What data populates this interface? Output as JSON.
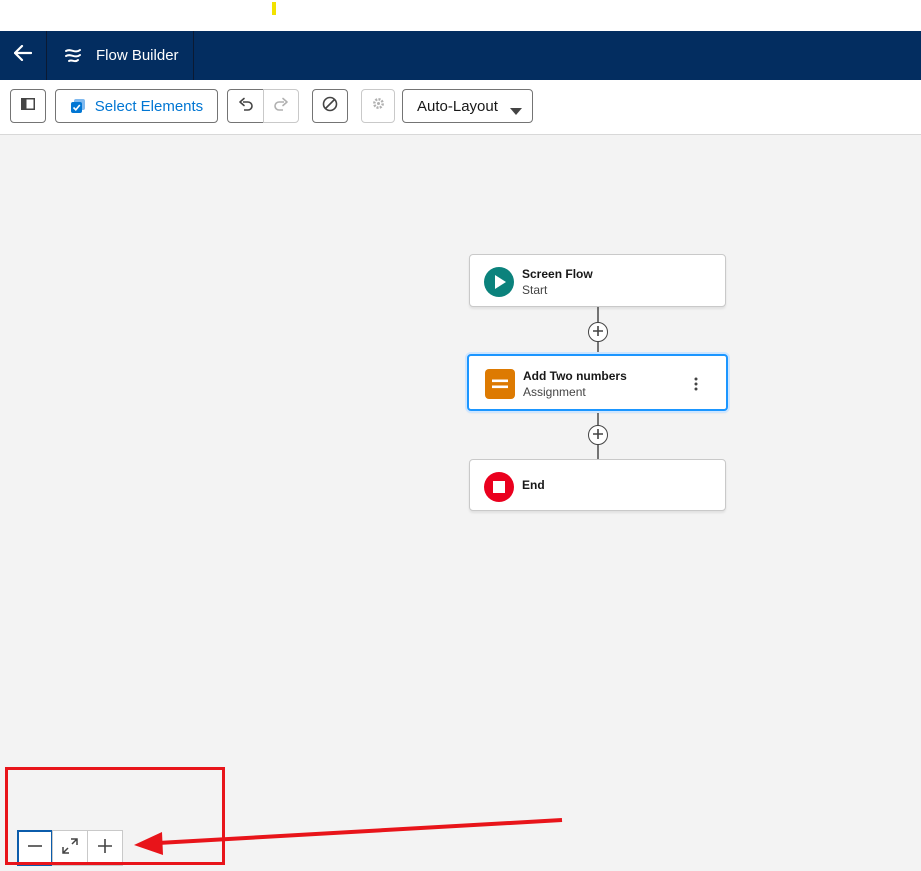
{
  "header": {
    "back_icon": "arrow-left-icon",
    "app_icon": "flow-icon",
    "app_title": "Flow Builder"
  },
  "toolbar": {
    "toggle_panel_icon": "panel-toggle-icon",
    "select_elements_label": "Select Elements",
    "select_elements_icon": "multi-select-icon",
    "undo_icon": "undo-icon",
    "redo_icon": "redo-icon",
    "ban_icon": "ban-icon",
    "settings_icon": "gear-icon",
    "layout_select": "Auto-Layout"
  },
  "flow": {
    "start": {
      "title": "Screen Flow",
      "subtitle": "Start",
      "icon": "play-icon",
      "color": "#0b827c"
    },
    "assignment": {
      "title": "Add Two numbers",
      "subtitle": "Assignment",
      "icon": "assignment-icon",
      "color": "#dd7a01"
    },
    "end": {
      "title": "End",
      "icon": "stop-icon",
      "color": "#ea001e"
    }
  },
  "zoom": {
    "zoom_out_icon": "minus-icon",
    "fit_icon": "expand-icon",
    "zoom_in_icon": "plus-icon"
  },
  "colors": {
    "header_bg": "#032d60",
    "brand_blue": "#0176d3",
    "annotation_red": "#e8141a"
  }
}
